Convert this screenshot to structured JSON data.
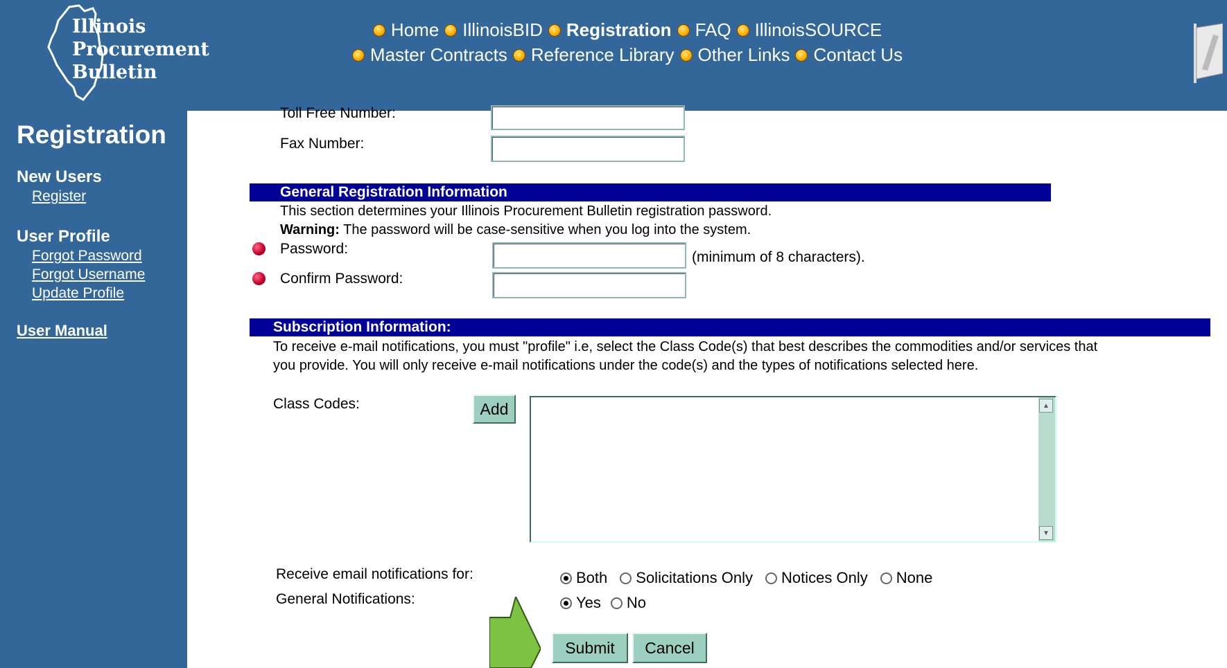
{
  "logo": {
    "line1": "Illinois",
    "line2": "Procurement",
    "line3": "Bulletin"
  },
  "nav": {
    "row1": [
      {
        "label": "Home",
        "active": false
      },
      {
        "label": "IllinoisBID",
        "active": false
      },
      {
        "label": "Registration",
        "active": true
      },
      {
        "label": "FAQ",
        "active": false
      },
      {
        "label": "IllinoisSOURCE",
        "active": false
      }
    ],
    "row2": [
      {
        "label": "Master Contracts",
        "active": false
      },
      {
        "label": "Reference Library",
        "active": false
      },
      {
        "label": "Other Links",
        "active": false
      },
      {
        "label": "Contact Us",
        "active": false
      }
    ]
  },
  "sidebar": {
    "title": "Registration",
    "new_users": "New Users",
    "register": "Register",
    "user_profile": "User Profile",
    "forgot_password": "Forgot Password",
    "forgot_username": "Forgot Username",
    "update_profile": "Update Profile",
    "user_manual": "User Manual"
  },
  "form": {
    "toll_free_label": "Toll Free Number:",
    "fax_label": "Fax Number:",
    "general_header": "General Registration Information",
    "general_text": "This section determines your Illinois Procurement Bulletin registration password.",
    "warning_label": "Warning:",
    "warning_text": " The password will be case-sensitive when you log into the system.",
    "password_label": "Password:",
    "password_hint": "(minimum of 8 characters).",
    "confirm_label": "Confirm Password:",
    "subscription_header": "Subscription Information:",
    "subscription_line1": "To receive e-mail notifications, you must \"profile\" i.e, select the Class Code(s) that best describes the commodities and/or services that",
    "subscription_line2": "you provide. You will only receive e-mail notifications under the code(s) and the types of notifications selected here.",
    "class_codes_label": "Class Codes:",
    "add_button": "Add",
    "receive_label": "Receive email notifications for:",
    "receive_options": [
      {
        "label": "Both",
        "selected": true
      },
      {
        "label": "Solicitations Only",
        "selected": false
      },
      {
        "label": "Notices Only",
        "selected": false
      },
      {
        "label": "None",
        "selected": false
      }
    ],
    "general_notif_label": "General Notifications:",
    "general_notif_options": [
      {
        "label": "Yes",
        "selected": true
      },
      {
        "label": "No",
        "selected": false
      }
    ],
    "submit_button": "Submit",
    "cancel_button": "Cancel"
  },
  "colors": {
    "header_bg": "#336699",
    "section_bar": "#000099",
    "button_bg": "#9ccfc0",
    "pointer_arrow": "#7dc242"
  }
}
